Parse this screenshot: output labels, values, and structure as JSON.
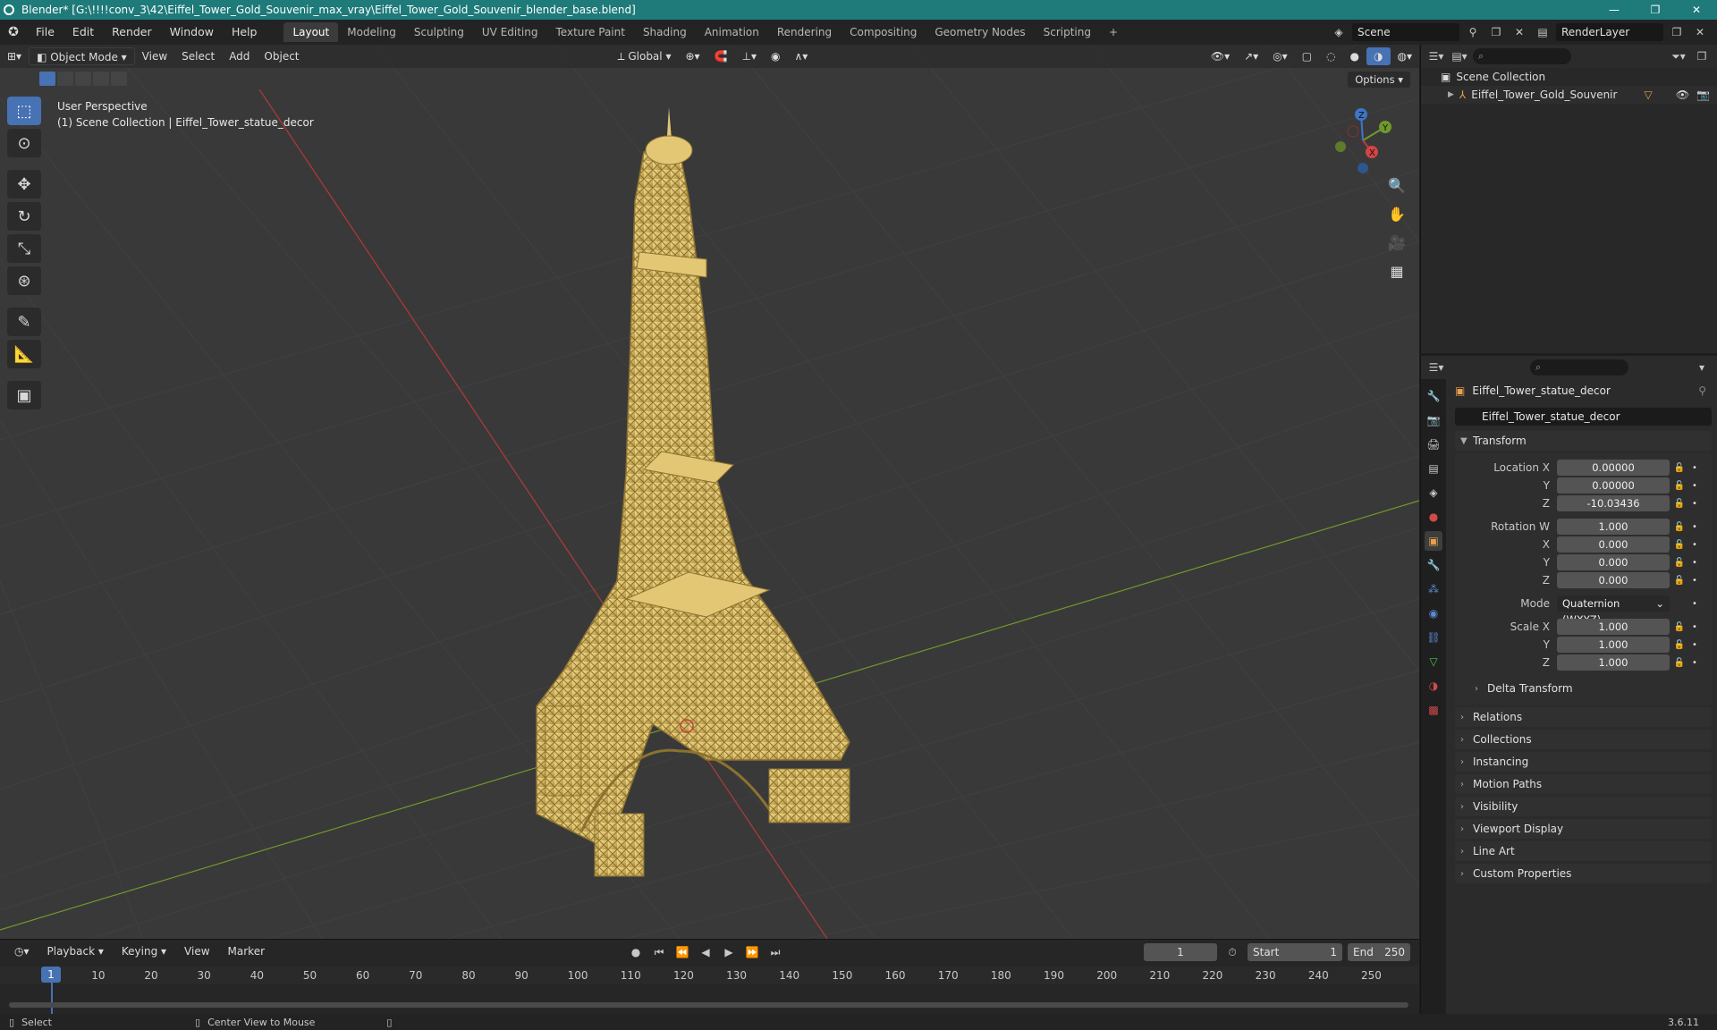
{
  "window": {
    "title": "Blender* [G:\\!!!!conv_3\\42\\Eiffel_Tower_Gold_Souvenir_max_vray\\Eiffel_Tower_Gold_Souvenir_blender_base.blend]",
    "minimize": "—",
    "maximize": "❐",
    "close": "✕"
  },
  "menu": [
    "File",
    "Edit",
    "Render",
    "Window",
    "Help"
  ],
  "workspaces": [
    "Layout",
    "Modeling",
    "Sculpting",
    "UV Editing",
    "Texture Paint",
    "Shading",
    "Animation",
    "Rendering",
    "Compositing",
    "Geometry Nodes",
    "Scripting",
    "+"
  ],
  "scene": {
    "name": "Scene",
    "render_layer": "RenderLayer"
  },
  "viewport": {
    "mode": "Object Mode",
    "menus": [
      "View",
      "Select",
      "Add",
      "Object"
    ],
    "transform_orientation": "Global",
    "options": "Options",
    "perspective_label": "User Perspective",
    "collection_label": "(1) Scene Collection | Eiffel_Tower_statue_decor",
    "gizmo": {
      "x": "X",
      "y": "Y",
      "z": "Z"
    }
  },
  "outliner": {
    "root": "Scene Collection",
    "items": [
      "Eiffel_Tower_Gold_Souvenir"
    ]
  },
  "properties": {
    "object_name": "Eiffel_Tower_statue_decor",
    "data_name": "Eiffel_Tower_statue_decor",
    "transform_title": "Transform",
    "location": {
      "label_x": "Location X",
      "x": "0.00000",
      "label_y": "Y",
      "y": "0.00000",
      "label_z": "Z",
      "z": "-10.03436"
    },
    "rotation": {
      "label_w": "Rotation W",
      "w": "1.000",
      "label_x": "X",
      "x": "0.000",
      "label_y": "Y",
      "y": "0.000",
      "label_z": "Z",
      "z": "0.000"
    },
    "mode_label": "Mode",
    "mode_value": "Quaternion (WXYZ)",
    "scale": {
      "label_x": "Scale X",
      "x": "1.000",
      "label_y": "Y",
      "y": "1.000",
      "label_z": "Z",
      "z": "1.000"
    },
    "delta_transform": "Delta Transform",
    "sections": [
      "Relations",
      "Collections",
      "Instancing",
      "Motion Paths",
      "Visibility",
      "Viewport Display",
      "Line Art",
      "Custom Properties"
    ]
  },
  "timeline": {
    "menus": [
      "Playback",
      "Keying",
      "View",
      "Marker"
    ],
    "current_frame": "1",
    "start_label": "Start",
    "start": "1",
    "end_label": "End",
    "end": "250",
    "ticks": [
      "1",
      "10",
      "20",
      "30",
      "40",
      "50",
      "60",
      "70",
      "80",
      "90",
      "100",
      "110",
      "120",
      "130",
      "140",
      "150",
      "160",
      "170",
      "180",
      "190",
      "200",
      "210",
      "220",
      "230",
      "240",
      "250"
    ]
  },
  "status": {
    "select": "Select",
    "center": "Center View to Mouse",
    "version": "3.6.11"
  },
  "colors": {
    "title_bar": "#1f7a7a",
    "accent": "#4772b3",
    "gold": "#d9bd6a",
    "x_axis": "#b03a3a",
    "y_axis": "#6f9a2a"
  }
}
